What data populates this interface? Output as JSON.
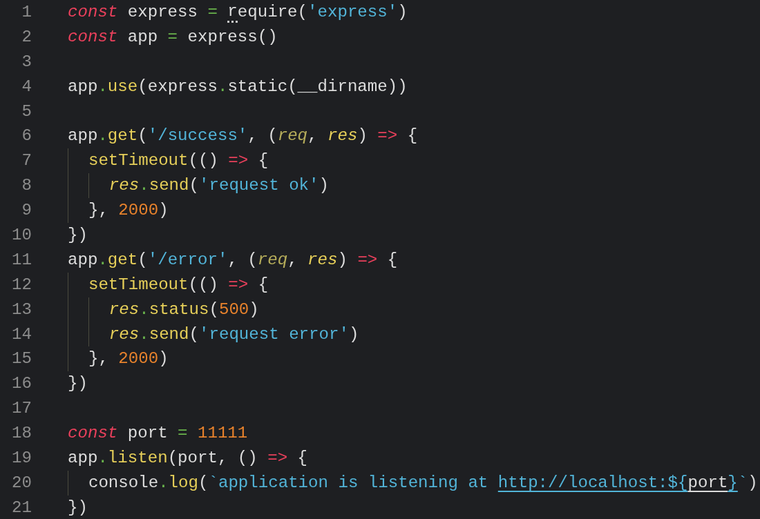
{
  "editor": {
    "lines": [
      {
        "number": "1",
        "tokens": [
          {
            "t": "const",
            "kind": "keyword"
          },
          {
            "t": " express ",
            "kind": "plain"
          },
          {
            "t": "= ",
            "kind": "op"
          },
          {
            "t": "r",
            "kind": "plain",
            "hint": true
          },
          {
            "t": "equire(",
            "kind": "plain"
          },
          {
            "t": "'express'",
            "kind": "string"
          },
          {
            "t": ")",
            "kind": "plain"
          }
        ]
      },
      {
        "number": "2",
        "tokens": [
          {
            "t": "const",
            "kind": "keyword"
          },
          {
            "t": " app ",
            "kind": "plain"
          },
          {
            "t": "=",
            "kind": "op"
          },
          {
            "t": " express()",
            "kind": "plain"
          }
        ]
      },
      {
        "number": "3"
      },
      {
        "number": "4",
        "tokens": [
          {
            "t": "app",
            "kind": "plain"
          },
          {
            "t": ".",
            "kind": "op"
          },
          {
            "t": "use",
            "kind": "func"
          },
          {
            "t": "(express",
            "kind": "plain"
          },
          {
            "t": ".",
            "kind": "op"
          },
          {
            "t": "static(__dirname))",
            "kind": "plain"
          }
        ]
      },
      {
        "number": "5"
      },
      {
        "number": "6",
        "tokens": [
          {
            "t": "app",
            "kind": "plain"
          },
          {
            "t": ".",
            "kind": "op"
          },
          {
            "t": "get",
            "kind": "func"
          },
          {
            "t": "(",
            "kind": "plain"
          },
          {
            "t": "'/success'",
            "kind": "string"
          },
          {
            "t": ", (",
            "kind": "plain"
          },
          {
            "t": "req",
            "kind": "param-unused"
          },
          {
            "t": ", ",
            "kind": "plain"
          },
          {
            "t": "res",
            "kind": "param"
          },
          {
            "t": ") ",
            "kind": "plain"
          },
          {
            "t": "=>",
            "kind": "arrow"
          },
          {
            "t": " {",
            "kind": "plain"
          }
        ]
      },
      {
        "number": "7",
        "tokens": [
          {
            "t": "  setTimeout",
            "kind": "func"
          },
          {
            "t": "(() ",
            "kind": "plain"
          },
          {
            "t": "=>",
            "kind": "arrow"
          },
          {
            "t": " {",
            "kind": "plain"
          }
        ]
      },
      {
        "number": "8",
        "tokens": [
          {
            "t": "    res",
            "kind": "param"
          },
          {
            "t": ".",
            "kind": "op"
          },
          {
            "t": "send",
            "kind": "func"
          },
          {
            "t": "(",
            "kind": "plain"
          },
          {
            "t": "'request ok'",
            "kind": "string"
          },
          {
            "t": ")",
            "kind": "plain"
          }
        ]
      },
      {
        "number": "9",
        "tokens": [
          {
            "t": "  }, ",
            "kind": "plain"
          },
          {
            "t": "2000",
            "kind": "number"
          },
          {
            "t": ")",
            "kind": "plain"
          }
        ]
      },
      {
        "number": "10",
        "tokens": [
          {
            "t": "})",
            "kind": "plain"
          }
        ]
      },
      {
        "number": "11",
        "tokens": [
          {
            "t": "app",
            "kind": "plain"
          },
          {
            "t": ".",
            "kind": "op"
          },
          {
            "t": "get",
            "kind": "func"
          },
          {
            "t": "(",
            "kind": "plain"
          },
          {
            "t": "'/error'",
            "kind": "string"
          },
          {
            "t": ", (",
            "kind": "plain"
          },
          {
            "t": "req",
            "kind": "param-unused"
          },
          {
            "t": ", ",
            "kind": "plain"
          },
          {
            "t": "res",
            "kind": "param"
          },
          {
            "t": ") ",
            "kind": "plain"
          },
          {
            "t": "=>",
            "kind": "arrow"
          },
          {
            "t": " {",
            "kind": "plain"
          }
        ]
      },
      {
        "number": "12",
        "tokens": [
          {
            "t": "  setTimeout",
            "kind": "func"
          },
          {
            "t": "(() ",
            "kind": "plain"
          },
          {
            "t": "=>",
            "kind": "arrow"
          },
          {
            "t": " {",
            "kind": "plain"
          }
        ]
      },
      {
        "number": "13",
        "tokens": [
          {
            "t": "    res",
            "kind": "param"
          },
          {
            "t": ".",
            "kind": "op"
          },
          {
            "t": "status",
            "kind": "func"
          },
          {
            "t": "(",
            "kind": "plain"
          },
          {
            "t": "500",
            "kind": "number"
          },
          {
            "t": ")",
            "kind": "plain"
          }
        ]
      },
      {
        "number": "14",
        "tokens": [
          {
            "t": "    res",
            "kind": "param"
          },
          {
            "t": ".",
            "kind": "op"
          },
          {
            "t": "send",
            "kind": "func"
          },
          {
            "t": "(",
            "kind": "plain"
          },
          {
            "t": "'request error'",
            "kind": "string"
          },
          {
            "t": ")",
            "kind": "plain"
          }
        ]
      },
      {
        "number": "15",
        "tokens": [
          {
            "t": "  }, ",
            "kind": "plain"
          },
          {
            "t": "2000",
            "kind": "number"
          },
          {
            "t": ")",
            "kind": "plain"
          }
        ]
      },
      {
        "number": "16",
        "tokens": [
          {
            "t": "})",
            "kind": "plain"
          }
        ]
      },
      {
        "number": "17"
      },
      {
        "number": "18",
        "tokens": [
          {
            "t": "const",
            "kind": "keyword"
          },
          {
            "t": " port ",
            "kind": "plain"
          },
          {
            "t": "= ",
            "kind": "op"
          },
          {
            "t": "11111",
            "kind": "number"
          }
        ]
      },
      {
        "number": "19",
        "tokens": [
          {
            "t": "app",
            "kind": "plain"
          },
          {
            "t": ".",
            "kind": "op"
          },
          {
            "t": "listen",
            "kind": "func"
          },
          {
            "t": "(port, () ",
            "kind": "plain"
          },
          {
            "t": "=>",
            "kind": "arrow"
          },
          {
            "t": " {",
            "kind": "plain"
          }
        ]
      },
      {
        "number": "20",
        "tokens": [
          {
            "t": "  console",
            "kind": "plain"
          },
          {
            "t": ".",
            "kind": "op"
          },
          {
            "t": "log",
            "kind": "func"
          },
          {
            "t": "(",
            "kind": "plain"
          },
          {
            "t": "`application is listening at ",
            "kind": "string"
          },
          {
            "t": "http://localhost:${",
            "kind": "string",
            "underline": true
          },
          {
            "t": "port",
            "kind": "plain",
            "underline": true
          },
          {
            "t": "}",
            "kind": "string",
            "underline": true
          },
          {
            "t": "`",
            "kind": "string"
          },
          {
            "t": ")",
            "kind": "plain"
          }
        ]
      },
      {
        "number": "21",
        "tokens": [
          {
            "t": "})",
            "kind": "plain"
          }
        ]
      }
    ]
  }
}
